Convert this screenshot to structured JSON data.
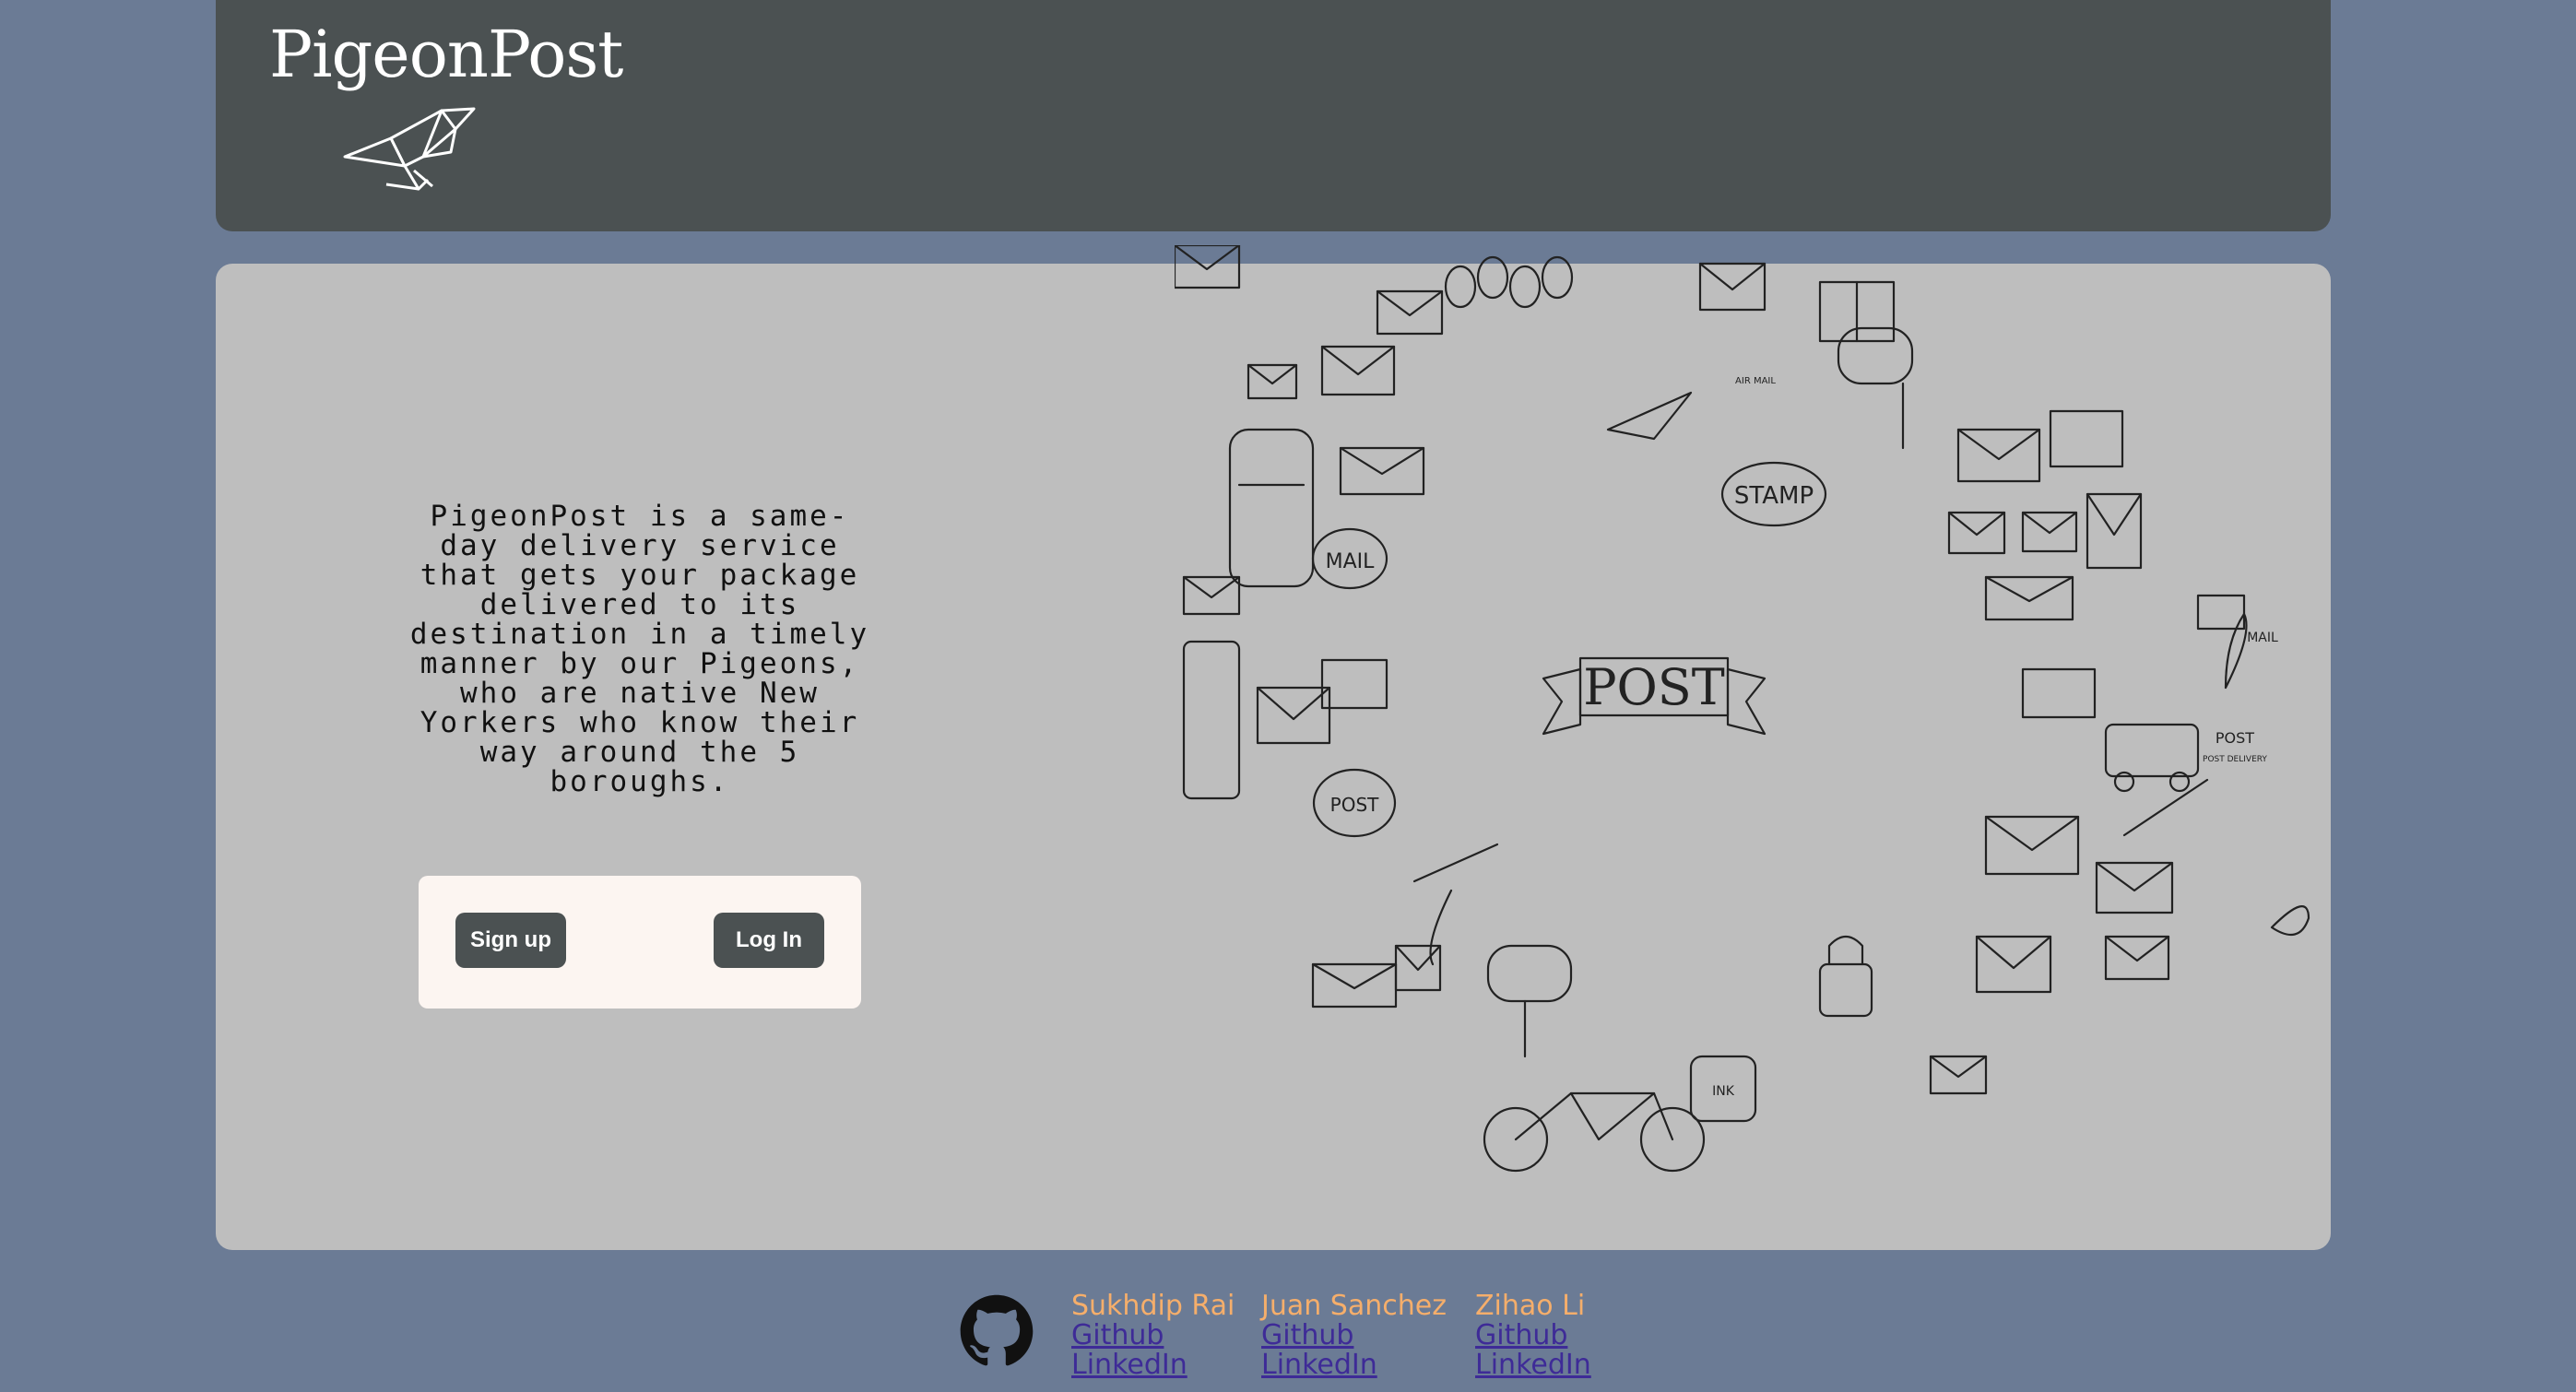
{
  "header": {
    "brand": "PigeonPost"
  },
  "main": {
    "description": "PigeonPost is a same-day delivery service that gets your package delivered to its destination in a timely manner by our Pigeons, who are native New Yorkers who know their way around the 5 boroughs.",
    "signup_label": "Sign up",
    "login_label": "Log In",
    "art_banner": "POST",
    "art_labels": [
      "STAMP",
      "MAIL",
      "POST",
      "INK",
      "MAIL",
      "POST",
      "AIR MAIL",
      "POST DELIVERY"
    ]
  },
  "footer": {
    "people": [
      {
        "name": "Sukhdip Rai",
        "github": "Github",
        "linkedin": "LinkedIn"
      },
      {
        "name": "Juan Sanchez",
        "github": "Github",
        "linkedin": "LinkedIn"
      },
      {
        "name": "Zihao Li",
        "github": "Github",
        "linkedin": "LinkedIn"
      }
    ]
  },
  "colors": {
    "page_bg": "#6b7b95",
    "header_bg": "#4b5152",
    "main_bg": "#bebebe",
    "button_bg": "#4b5152",
    "name_color": "#f5ae6b",
    "link_color": "#3e2b97"
  }
}
